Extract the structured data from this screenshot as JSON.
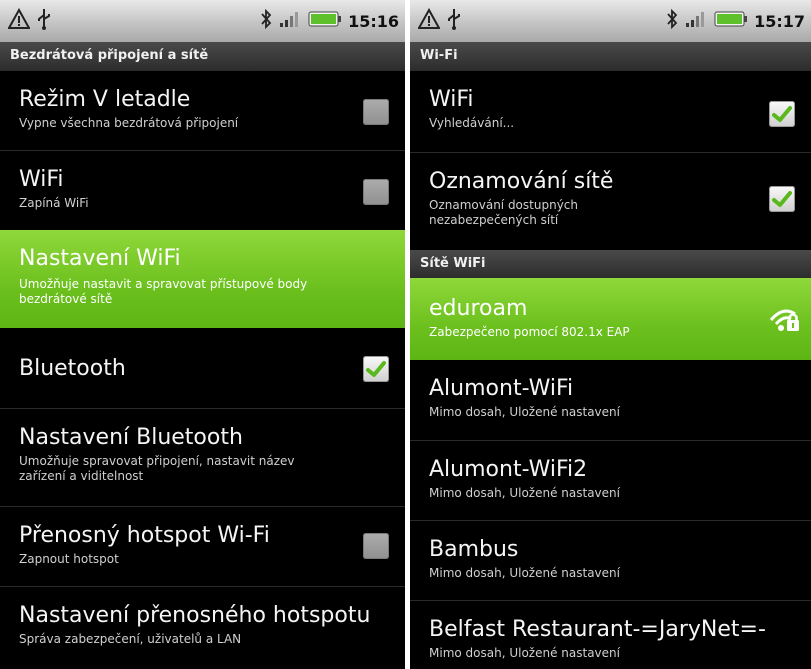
{
  "left": {
    "status": {
      "time": "15:16"
    },
    "header": "Bezdrátová připojení a sítě",
    "items": [
      {
        "title": "Režim V letadle",
        "subtitle": "Vypne všechna bezdrátová připojení",
        "checkbox": "unchecked"
      },
      {
        "title": "WiFi",
        "subtitle": "Zapíná WiFi",
        "checkbox": "unchecked"
      },
      {
        "title": "Nastavení WiFi",
        "subtitle": "Umožňuje nastavit a spravovat přístupové body",
        "subtitle2": "bezdrátové sítě",
        "highlighted": true
      },
      {
        "title": "Bluetooth",
        "checkbox": "checked"
      },
      {
        "title": "Nastavení Bluetooth",
        "subtitle": "Umožňuje spravovat připojení, nastavit název",
        "subtitle2": "zařízení a viditelnost"
      },
      {
        "title": "Přenosný hotspot Wi-Fi",
        "subtitle": "Zapnout hotspot",
        "checkbox": "unchecked"
      },
      {
        "title": "Nastavení přenosného hotspotu",
        "subtitle": "Správa zabezpečení, uživatelů a LAN"
      }
    ]
  },
  "right": {
    "status": {
      "time": "15:17"
    },
    "header_wifi": "Wi-Fi",
    "items": [
      {
        "title": "WiFi",
        "subtitle": "Vyhledávání...",
        "checkbox": "checked"
      },
      {
        "title": "Oznamování sítě",
        "subtitle": "Oznamování dostupných",
        "subtitle2": "nezabezpečených sítí",
        "checkbox": "checked"
      }
    ],
    "header_networks": "Sítě WiFi",
    "networks": [
      {
        "title": "eduroam",
        "subtitle": "Zabezpečeno pomocí 802.1x EAP",
        "highlighted": true,
        "icon": "wifi-lock-icon"
      },
      {
        "title": "Alumont-WiFi",
        "subtitle": "Mimo dosah, Uložené nastavení"
      },
      {
        "title": "Alumont-WiFi2",
        "subtitle": "Mimo dosah, Uložené nastavení"
      },
      {
        "title": "Bambus",
        "subtitle": "Mimo dosah, Uložené nastavení"
      },
      {
        "title": "Belfast Restaurant-=JaryNet=-",
        "subtitle": "Mimo dosah, Uložené nastavení"
      }
    ]
  },
  "colors": {
    "highlight": "#6cc01e",
    "check": "#58b81c",
    "background": "#000000"
  },
  "status_icons": [
    "warning-icon",
    "usb-icon",
    "bluetooth-icon",
    "signal-icon",
    "battery-icon"
  ]
}
